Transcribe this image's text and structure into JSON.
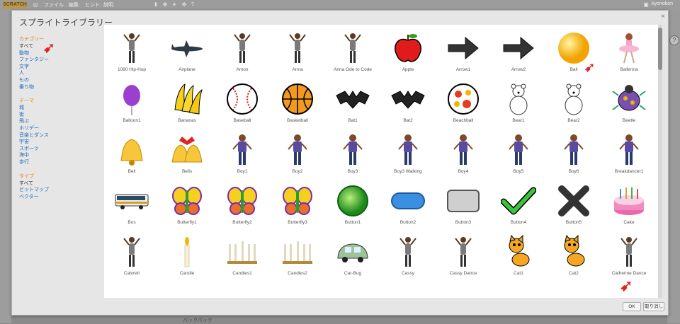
{
  "appbar": {
    "logo": "SCRATCH",
    "menus": [
      "ファイル",
      "編集",
      "ヒント",
      "説明"
    ],
    "user": "kyonokon"
  },
  "dialog": {
    "title": "スプライトライブラリー",
    "close": "×",
    "ok": "OK",
    "cancel": "取り消し"
  },
  "sidebar": {
    "category_head": "カテゴリー",
    "categories": [
      "すべて",
      "動物",
      "ファンタジー",
      "文字",
      "人",
      "もの",
      "乗り物"
    ],
    "theme_head": "テーマ",
    "themes": [
      "城",
      "街",
      "飛ぶ",
      "ホリデー",
      "音楽とダンス",
      "宇宙",
      "スポーツ",
      "海中",
      "歩行"
    ],
    "type_head": "タイプ",
    "types": [
      "すべて",
      "ビットマップ",
      "ベクター"
    ]
  },
  "sprites": [
    {
      "name": "1080 Hip-Hop",
      "icon": "dancer-icon"
    },
    {
      "name": "Airplane",
      "icon": "airplane-icon"
    },
    {
      "name": "Amon",
      "icon": "dancer-icon"
    },
    {
      "name": "Anna",
      "icon": "dancer-icon"
    },
    {
      "name": "Anna Ode to Code",
      "icon": "dancer-icon"
    },
    {
      "name": "Apple",
      "icon": "apple-icon"
    },
    {
      "name": "Arrow1",
      "icon": "arrow-icon"
    },
    {
      "name": "Arrow2",
      "icon": "arrow-icon"
    },
    {
      "name": "Ball",
      "icon": "ball-icon"
    },
    {
      "name": "Ballerina",
      "icon": "ballerina-icon"
    },
    {
      "name": "Balloon1",
      "icon": "balloon-icon"
    },
    {
      "name": "Bananas",
      "icon": "bananas-icon"
    },
    {
      "name": "Baseball",
      "icon": "baseball-icon"
    },
    {
      "name": "Basketball",
      "icon": "basketball-icon"
    },
    {
      "name": "Bat1",
      "icon": "bat-icon"
    },
    {
      "name": "Bat2",
      "icon": "bat-icon"
    },
    {
      "name": "Beachball",
      "icon": "beachball-icon"
    },
    {
      "name": "Bear1",
      "icon": "bear-icon"
    },
    {
      "name": "Bear2",
      "icon": "bear-icon"
    },
    {
      "name": "Beetle",
      "icon": "beetle-icon"
    },
    {
      "name": "Bell",
      "icon": "bell-icon"
    },
    {
      "name": "Bells",
      "icon": "bells-icon"
    },
    {
      "name": "Boy1",
      "icon": "boy-icon"
    },
    {
      "name": "Boy2",
      "icon": "boy-icon"
    },
    {
      "name": "Boy3",
      "icon": "boy-icon"
    },
    {
      "name": "Boy3 Walking",
      "icon": "boy-icon"
    },
    {
      "name": "Boy4",
      "icon": "boy-icon"
    },
    {
      "name": "Boy5",
      "icon": "boy-icon"
    },
    {
      "name": "Boy6",
      "icon": "boy-icon"
    },
    {
      "name": "Breakdancer1",
      "icon": "boy-icon"
    },
    {
      "name": "Bus",
      "icon": "bus-icon"
    },
    {
      "name": "Butterfly1",
      "icon": "butterfly-icon"
    },
    {
      "name": "Butterfly2",
      "icon": "butterfly-icon"
    },
    {
      "name": "Butterfly3",
      "icon": "butterfly-icon"
    },
    {
      "name": "Button1",
      "icon": "button-round-icon"
    },
    {
      "name": "Button2",
      "icon": "button-pill-icon"
    },
    {
      "name": "Button3",
      "icon": "button-rect-icon"
    },
    {
      "name": "Button4",
      "icon": "checkmark-icon"
    },
    {
      "name": "Button5",
      "icon": "x-mark-icon"
    },
    {
      "name": "Cake",
      "icon": "cake-icon"
    },
    {
      "name": "Calvrett",
      "icon": "dancer-icon"
    },
    {
      "name": "Candle",
      "icon": "candle-icon"
    },
    {
      "name": "Candles1",
      "icon": "candles-icon"
    },
    {
      "name": "Candles2",
      "icon": "candles-icon"
    },
    {
      "name": "Car-Bug",
      "icon": "car-icon"
    },
    {
      "name": "Cassy",
      "icon": "dancer-icon"
    },
    {
      "name": "Cassy Dance",
      "icon": "dancer-icon"
    },
    {
      "name": "Cat1",
      "icon": "cat-icon"
    },
    {
      "name": "Cat2",
      "icon": "cat-icon"
    },
    {
      "name": "Catherine Dance",
      "icon": "dancer-icon"
    }
  ]
}
